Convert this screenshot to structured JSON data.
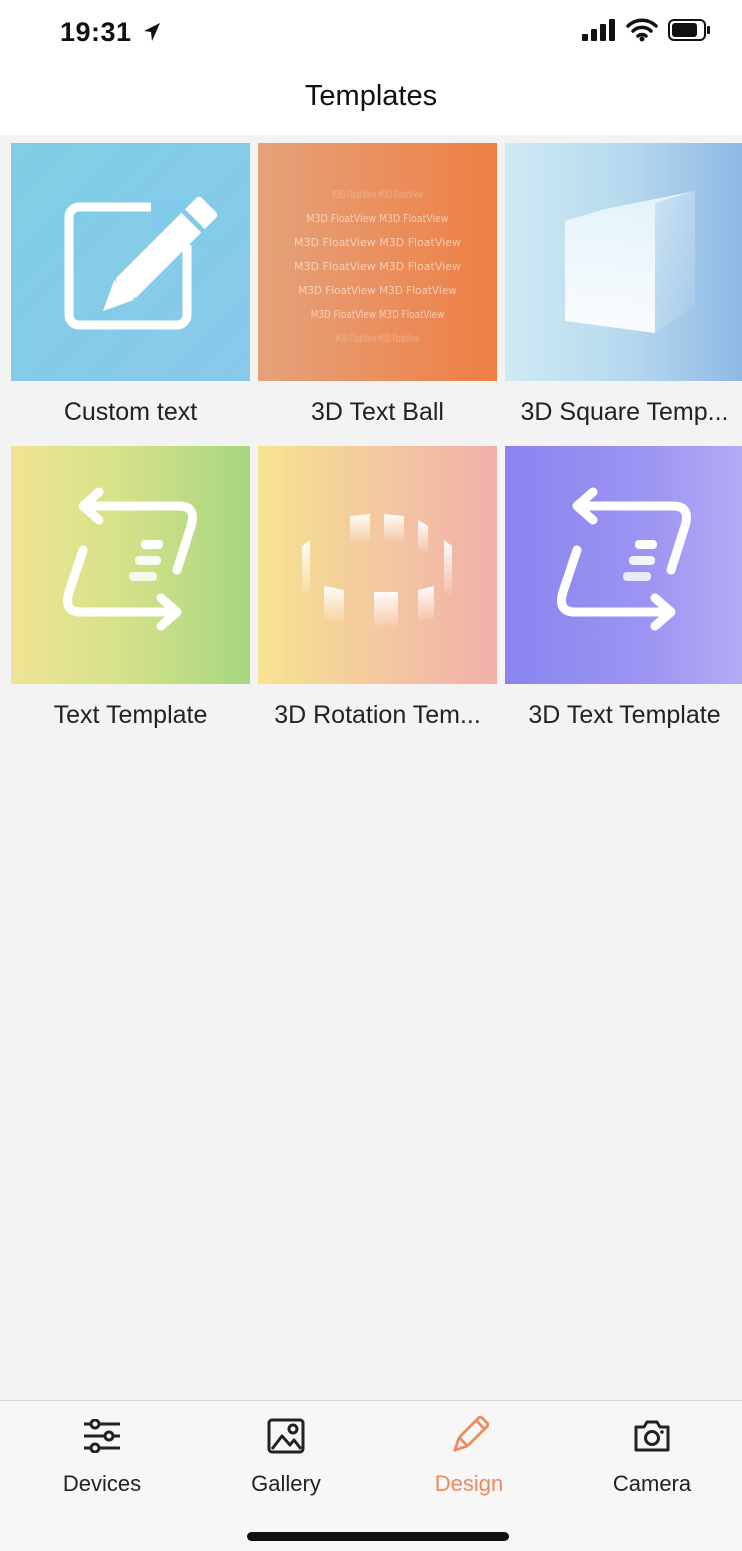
{
  "status_bar": {
    "time": "19:31",
    "icons": [
      "location-arrow-icon",
      "signal-icon",
      "wifi-icon",
      "battery-icon"
    ]
  },
  "header": {
    "title": "Templates"
  },
  "templates": [
    {
      "label": "Custom text",
      "icon": "pencil-edit-icon",
      "colors": [
        "#7fcfe4",
        "#8ac8ec"
      ]
    },
    {
      "label": "3D Text Ball",
      "icon": "text-sphere-icon",
      "colors": [
        "#e5a27b",
        "#ee7f44"
      ],
      "ball_text": "M3D FloatView M3D FloatView"
    },
    {
      "label": "3D Square Temp...",
      "icon": "cube-icon",
      "colors": [
        "#cfeaf3",
        "#8fb8e6"
      ]
    },
    {
      "label": "Text Template",
      "icon": "text-cycle-icon",
      "colors": [
        "#efe494",
        "#a7d681"
      ]
    },
    {
      "label": "3D Rotation Tem...",
      "icon": "rotation-panels-icon",
      "colors": [
        "#f6e38f",
        "#f1b0aa"
      ]
    },
    {
      "label": "3D Text Template",
      "icon": "text-cycle-icon",
      "colors": [
        "#8a84ef",
        "#b2acf5"
      ]
    }
  ],
  "tab_bar": {
    "active": "design",
    "accent_color": "#ee8a5c",
    "tabs": [
      {
        "id": "devices",
        "label": "Devices",
        "icon": "sliders-icon"
      },
      {
        "id": "gallery",
        "label": "Gallery",
        "icon": "image-icon"
      },
      {
        "id": "design",
        "label": "Design",
        "icon": "pencil-icon"
      },
      {
        "id": "camera",
        "label": "Camera",
        "icon": "camera-icon"
      }
    ]
  }
}
